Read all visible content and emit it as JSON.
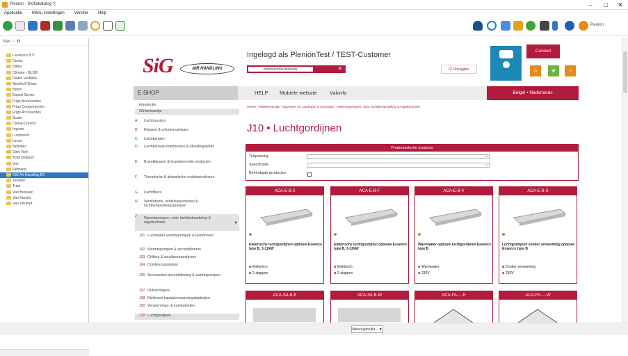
{
  "window": {
    "title": "Plenion - Stofiakatalog *]",
    "min": "–",
    "max": "□",
    "close": "✕"
  },
  "menu": [
    "Applicatie",
    "Menu instellingen",
    "Venster",
    "Help"
  ],
  "tree": {
    "toolbar": "Nav ↑↓ ✿",
    "items": [
      "Laurenzo B.V.",
      "Centry",
      "Dikka",
      "Climate - BLOB",
      "Daikin Verbeke",
      "Beckhoff Bouw",
      "Beluci",
      "Export Senior",
      "Frigo Accessoires",
      "Frigo Componenten",
      "Frigo Accessoires",
      "Scala",
      "Climat-Control",
      "Ingram",
      "Lundotech",
      "Linum",
      "Nelsatec",
      "Sinn Tech",
      "Total Belgium",
      "Vos",
      "Rebrand",
      "SIG Air Handling BV",
      "Tentalio",
      "Trias",
      "Van Breusen",
      "Van Kerche",
      "Van Strumpf"
    ],
    "selected_index": 21
  },
  "site": {
    "logo_main": "SiG",
    "logo_sub": "AIR HANDLING",
    "login_text": "Ingelogd als PlenionTest / TEST-Customer",
    "login_field": "PRODUCTEN ZOEKEN",
    "login_go": "ok",
    "logout": "Uitloggen",
    "contact": "Contact",
    "region": "België • Nederlands",
    "nav": [
      "HELP",
      "Mobiele website",
      "Vakinfo"
    ],
    "breadcrumb": "Home › Winkelmandje › Opzetten en catalogus & toezingen › Warmtepompen, ontv. luchtbehandeling & regeltechniek",
    "eshop": "E-SHOP",
    "menu": [
      {
        "code": "",
        "label": "Introductie"
      },
      {
        "code": "",
        "label": "Winkelmandje"
      },
      {
        "code": "A",
        "label": "Luchtroosters"
      },
      {
        "code": "B",
        "label": "Kleppen & volumeregelaars"
      },
      {
        "code": "C",
        "label": "Luchtkanalen"
      },
      {
        "code": "D",
        "label": "Luchtkanaalcomponenten & afsluitingskitten"
      },
      {
        "code": "E",
        "label": "Brandkleppen & brandwerende producten"
      },
      {
        "code": "F",
        "label": "Thermische & akoestische isolatieproducten"
      },
      {
        "code": "G",
        "label": "Luchtfilters"
      },
      {
        "code": "H",
        "label": "Ventilatoren, ventilatiesystemen & luchtbehandelingsgroepen"
      },
      {
        "code": "J",
        "label": "Warmtepompen, ontv. luchtbehandeling & regeltechniek"
      }
    ],
    "submenu": [
      {
        "code": "J01",
        "label": "Luchtwater warmtepompen & toebehoren"
      },
      {
        "code": "J02",
        "label": "Warmtepompen & airconditioners"
      },
      {
        "code": "J03",
        "label": "Chillers & ventilatoraandrijvers"
      },
      {
        "code": "J04",
        "label": "Condensorpompen"
      },
      {
        "code": "J05",
        "label": "Accessoires airconditioning & warmtepompen"
      },
      {
        "code": "J07",
        "label": "Ontvochtigers"
      },
      {
        "code": "J08",
        "label": "Elektrisch kanaalverwarmingsbatterijen"
      },
      {
        "code": "J09",
        "label": "Verwarmings- & koelbatterijen"
      },
      {
        "code": "J10",
        "label": "Luchtgordijnen"
      }
    ],
    "heading": "J10 • Luchtgordijnen",
    "selector": {
      "title": "Productselectie products",
      "row1": "Toepassing",
      "row2": "Specificatie",
      "row3": "Beëindigde producten"
    },
    "products": [
      {
        "code": "ACA-E-B-2",
        "desc": "Elektrische luchtgordijnen opbouw Essence type B, 3-12kW",
        "b1": "Elektrisch",
        "b2": "2-stappen"
      },
      {
        "code": "ACA-E-B-F",
        "desc": "Elektrische luchtgordijnen opbouw Essence type B, 3-12kW",
        "b1": "Elektrisch",
        "b2": "2-stappen"
      },
      {
        "code": "ACA-E-B-V",
        "desc": "Warmwater opbouw luchtgordijnen Essence type B",
        "b1": "Warmwater",
        "b2": "230V"
      },
      {
        "code": "ACA-E-B-S",
        "desc": "Luchtgordijnen zonder verwarming opbouw Essence type B",
        "b1": "Zonder verwarming",
        "b2": "230V"
      }
    ],
    "products_row2": [
      "ACA-S4-B-E",
      "ACA-S4-B-W",
      "ACA-FA-...-E",
      "ACA-FA-...-W"
    ]
  },
  "status": {
    "button": "Meest gebruikt..."
  },
  "colors": {
    "brand": "#b11b3c",
    "chat": "#1d88b6",
    "orange": "#e88a1b",
    "green": "#6db33f"
  }
}
